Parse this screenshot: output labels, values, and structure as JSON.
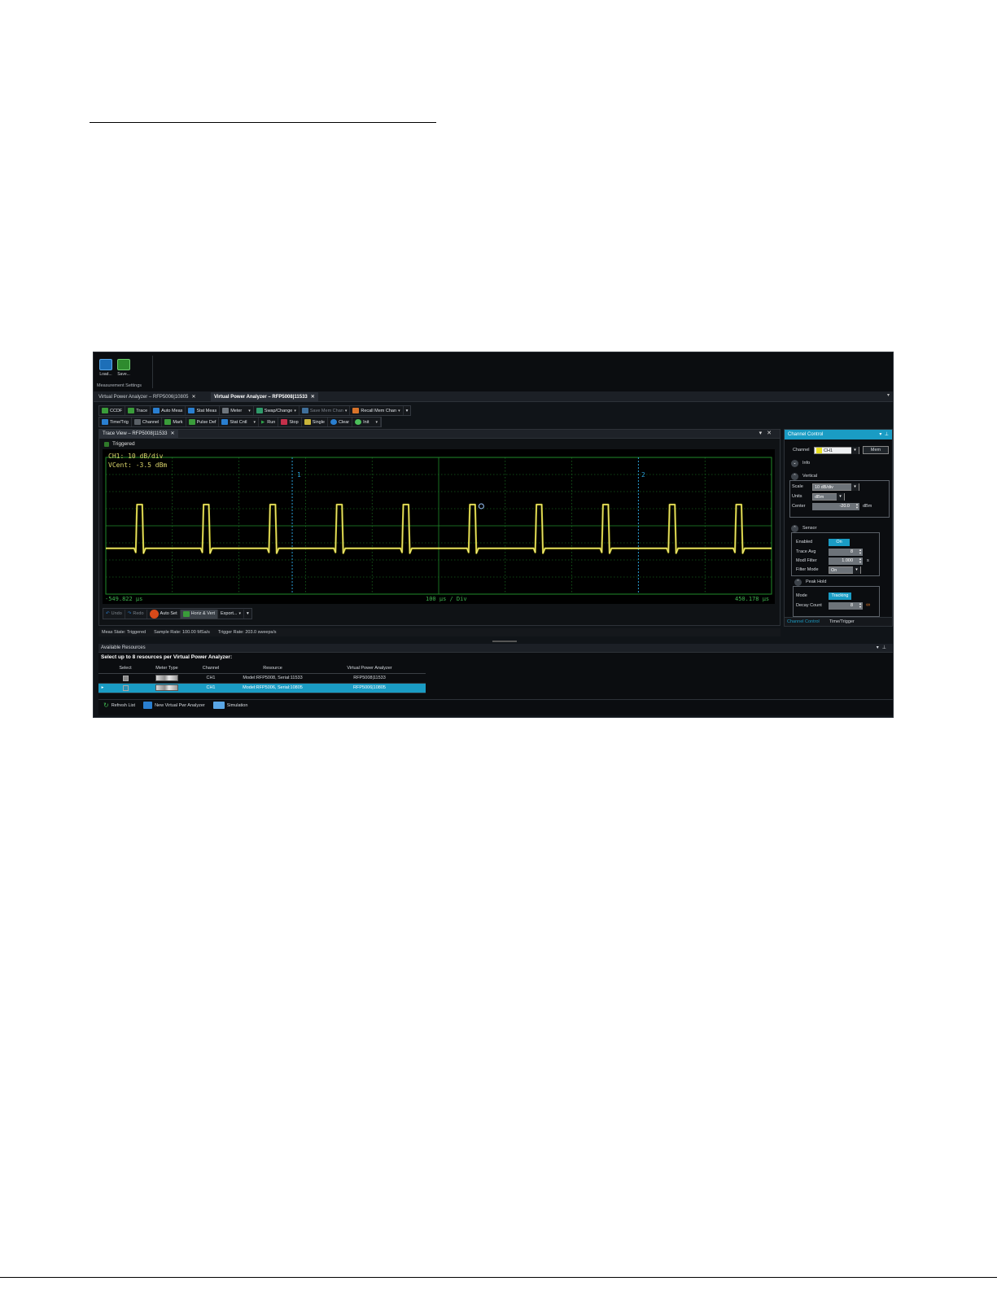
{
  "ribbon": {
    "load_label": "Load...",
    "save_label": "Save...",
    "group_label": "Measurement Settings"
  },
  "doc_tabs": [
    {
      "label": "Virtual Power Analyzer – RFP5006|10805",
      "active": false
    },
    {
      "label": "Virtual Power Analyzer – RFP5008|11533",
      "active": true
    }
  ],
  "toolbar1": {
    "ccdf": "CCDF",
    "trace": "Trace",
    "auto_meas": "Auto Meas",
    "stat_meas": "Stat Meas",
    "meter": "Meter",
    "swap_change": "Swap/Change",
    "save_mem_chan": "Save Mem Chan",
    "recall_mem_chan": "Recall Mem Chan"
  },
  "toolbar2": {
    "time_trig": "Time/Trig",
    "channel": "Channel",
    "mark": "Mark",
    "pulse_def": "Pulse Def",
    "stat_cntl": "Stat Cntl",
    "run": "Run",
    "stop": "Stop",
    "single": "Single",
    "clear": "Clear",
    "init": "Init"
  },
  "trace_view": {
    "tab_label": "Trace View – RFP5008|11533",
    "triggered": "Triggered",
    "ch_scale": "CH1: 10 dB/div",
    "vcent": "VCent: -3.5 dBm",
    "marker1": "1",
    "marker2": "2",
    "x_left": "-549.822 μs",
    "x_center": "100 μs / Div",
    "x_right": "450.178 μs",
    "pulse_count": 10,
    "colors": {
      "grid": "#1f8a2a",
      "trace": "#e3dc2a",
      "marker": "#2a9bd4"
    }
  },
  "trace_bottom": {
    "undo": "Undo",
    "redo": "Redo",
    "auto_set": "Auto Set",
    "horiz_vert": "Horiz & Vert",
    "export": "Export..."
  },
  "status": {
    "meas_state": "Meas State: Triggered",
    "sample_rate": "Sample Rate: 100.00 MSa/s",
    "trigger_rate": "Trigger Rate: 203.0 sweeps/s"
  },
  "channel_control": {
    "title": "Channel Control",
    "channel_label": "Channel",
    "channel_value": "CH1",
    "mem_label": "Mem",
    "info_label": "Info",
    "vertical_label": "Vertical",
    "scale_label": "Scale",
    "scale_value": "10 dB/div",
    "units_label": "Units",
    "units_value": "dBm",
    "center_label": "Center",
    "center_value": "-20.0",
    "center_unit": "dBm",
    "sensor_label": "Sensor",
    "enabled_label": "Enabled",
    "enabled_value": "On",
    "trace_avg_label": "Trace Avg",
    "trace_avg_value": "8",
    "modl_filter_label": "Modl Filter",
    "modl_filter_value": "1.000",
    "modl_filter_unit": "s",
    "filter_mode_label": "Filter Mode",
    "filter_mode_value": "On",
    "peak_hold_label": "Peak Hold",
    "mode_label": "Mode",
    "mode_value": "Tracking",
    "decay_count_label": "Decay Count",
    "decay_count_value": "8",
    "tabs": [
      "Channel Control",
      "Time/Trigger"
    ]
  },
  "resources": {
    "header": "Available Resources",
    "title": "Select up to 8 resources per Virtual Power Analyzer:",
    "columns": [
      "Select",
      "Meter Type",
      "Channel",
      "Resource",
      "Virtual Power Analyzer"
    ],
    "rows": [
      {
        "channel": "CH1",
        "resource": "Model:RFP5008, Serial:11533",
        "vpa": "RFP5008|11533",
        "selected": false
      },
      {
        "channel": "CH1",
        "resource": "Model:RFP5006, Serial:10805",
        "vpa": "RFP5006|10805",
        "selected": true
      }
    ],
    "footer": {
      "refresh": "Refresh List",
      "new_vpa": "New Virtual Pwr Analyzer",
      "simulation": "Simulation"
    }
  }
}
